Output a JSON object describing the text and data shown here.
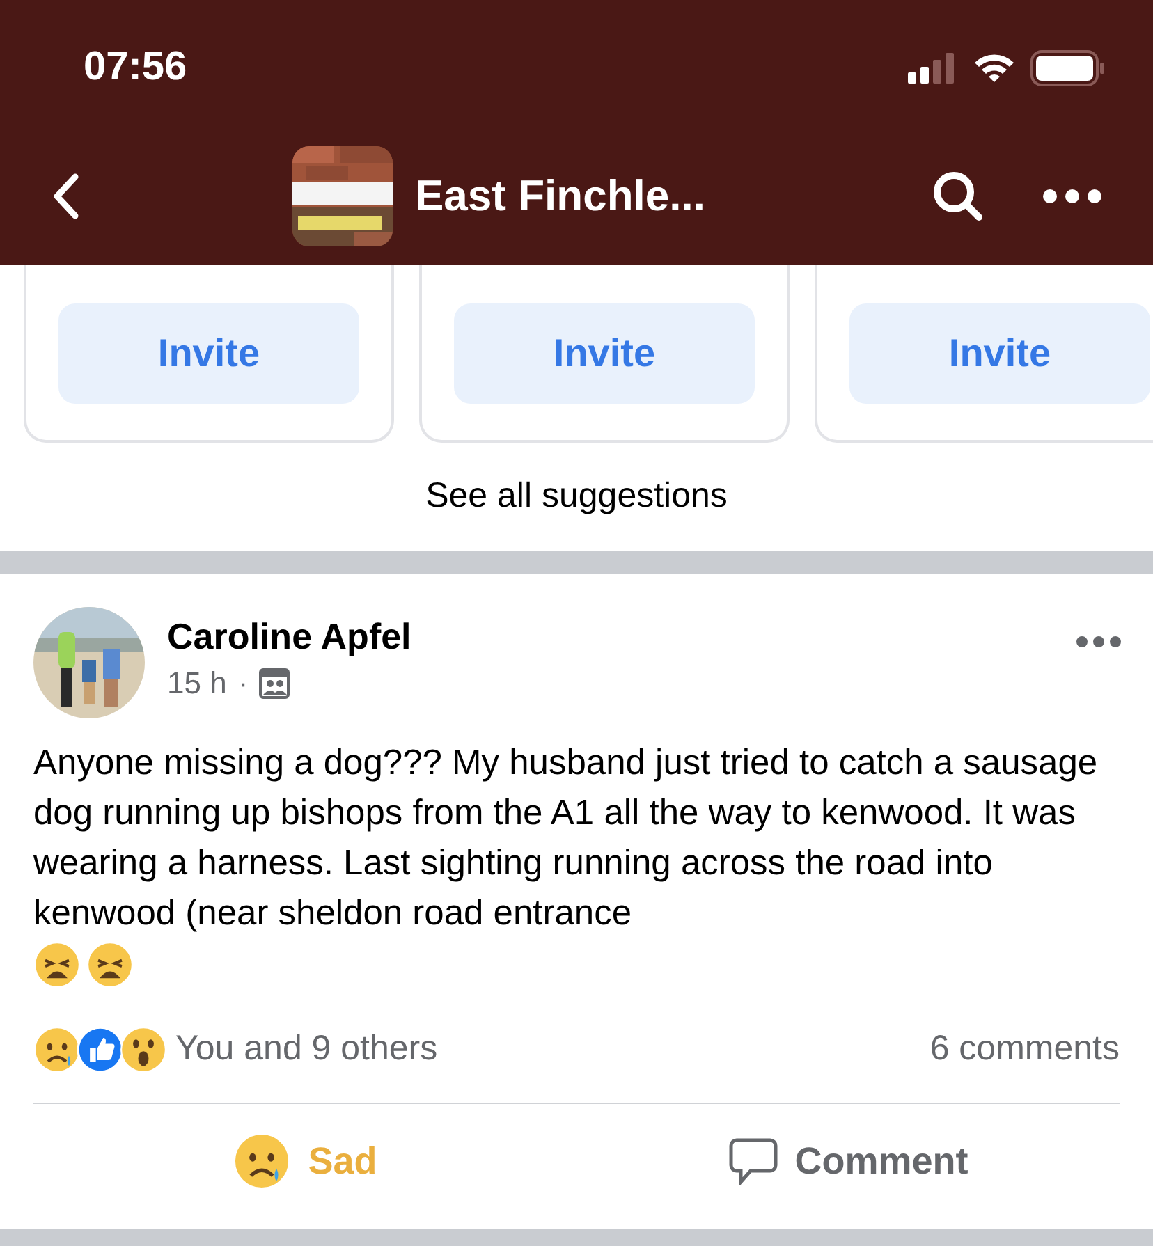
{
  "status_bar": {
    "time": "07:56"
  },
  "header": {
    "title": "East Finchle..."
  },
  "suggestions": {
    "cards": [
      {
        "button": "Invite"
      },
      {
        "button": "Invite"
      },
      {
        "button": "Invite"
      }
    ],
    "see_all": "See all suggestions"
  },
  "post": {
    "author": "Caroline Apfel",
    "time": "15 h",
    "separator": "·",
    "text": "Anyone missing a dog??? My husband just tried to catch a sausage dog running up bishops from the A1 all the way to kenwood. It was wearing a harness. Last sighting running across the road into kenwood (near sheldon road entrance",
    "text_emojis": [
      {
        "kind": "weary"
      },
      {
        "kind": "weary"
      }
    ],
    "reactions": [
      {
        "kind": "sad"
      },
      {
        "kind": "like"
      },
      {
        "kind": "wow"
      }
    ],
    "reaction_summary": "You and 9 others",
    "comments": "6 comments",
    "actions": [
      {
        "kind": "sad",
        "label": "Sad",
        "active": true
      },
      {
        "kind": "comment",
        "label": "Comment",
        "active": false
      }
    ]
  }
}
